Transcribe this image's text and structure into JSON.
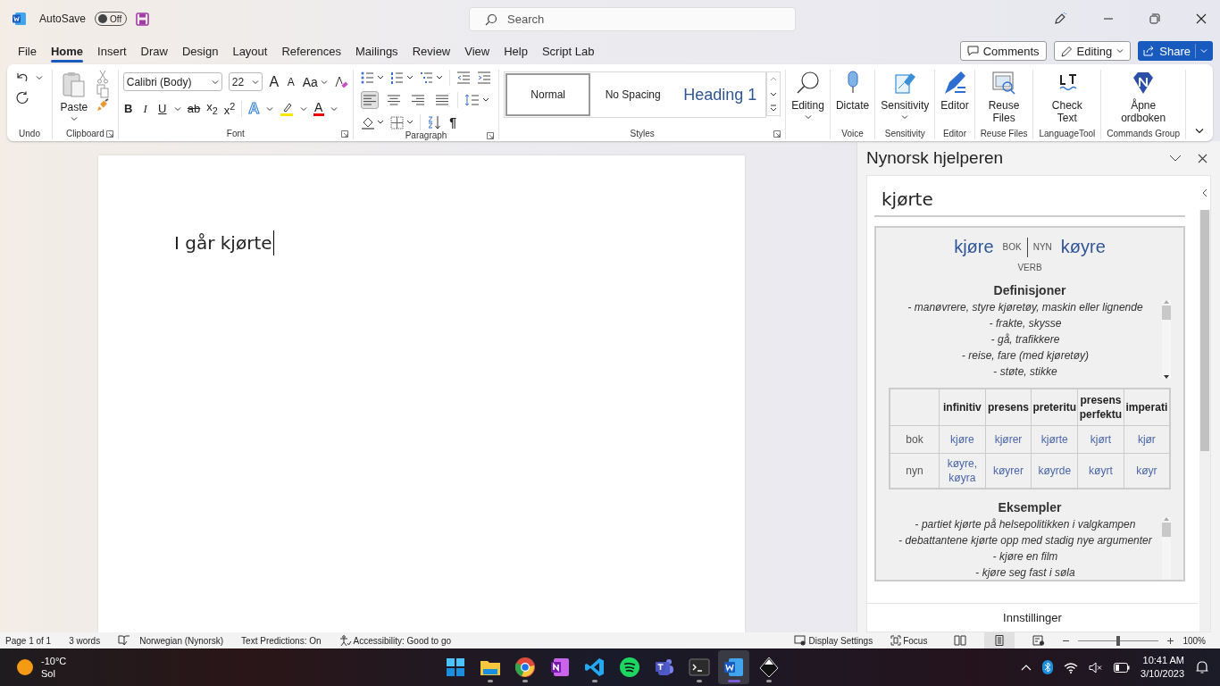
{
  "titlebar": {
    "autosave_label": "AutoSave",
    "autosave": {
      "on": false,
      "label": "Off"
    },
    "search": {
      "placeholder": "Search"
    }
  },
  "menu_tabs": [
    {
      "label": "File",
      "selected": false
    },
    {
      "label": "Home",
      "selected": true
    },
    {
      "label": "Insert",
      "selected": false
    },
    {
      "label": "Draw",
      "selected": false
    },
    {
      "label": "Design",
      "selected": false
    },
    {
      "label": "Layout",
      "selected": false
    },
    {
      "label": "References",
      "selected": false
    },
    {
      "label": "Mailings",
      "selected": false
    },
    {
      "label": "Review",
      "selected": false
    },
    {
      "label": "View",
      "selected": false
    },
    {
      "label": "Help",
      "selected": false
    },
    {
      "label": "Script Lab",
      "selected": false
    }
  ],
  "top_buttons": {
    "comments": "Comments",
    "editing": "Editing",
    "share": "Share"
  },
  "ribbon": {
    "undo": {
      "label": "Undo"
    },
    "clipboard": {
      "paste": "Paste",
      "label": "Clipboard"
    },
    "font": {
      "font_name": "Calibri (Body)",
      "font_size": "22",
      "case_button": "Aa",
      "size_buttons": [
        {
          "label": "A",
          "kind": "grow"
        },
        {
          "label": "A",
          "kind": "shrink"
        }
      ],
      "format_buttons": [
        {
          "label": "B",
          "kind": "bold"
        },
        {
          "label": "I",
          "kind": "italic"
        },
        {
          "label": "U",
          "kind": "underline"
        },
        {
          "label": "ab",
          "kind": "strike"
        },
        {
          "label": "x$_{2}$",
          "kind": "plain"
        },
        {
          "label": "x$^{2}$",
          "kind": "plain"
        }
      ],
      "color_buttons": [
        {
          "label": "A",
          "kind": "effect"
        },
        {
          "label": "A",
          "kind": "color"
        }
      ],
      "label": "Font"
    },
    "paragraph": {
      "align": [
        {
          "selected": true
        },
        {
          "selected": false
        },
        {
          "selected": false
        },
        {
          "selected": false
        }
      ],
      "pilcrow": "¶",
      "label": "Paragraph"
    },
    "styles": {
      "items": [
        {
          "label": "Normal",
          "selected": true,
          "kind": "body"
        },
        {
          "label": "No Spacing",
          "selected": false,
          "kind": "body"
        },
        {
          "label": "Heading 1",
          "selected": false,
          "kind": "heading"
        }
      ],
      "label": "Styles"
    },
    "big_buttons": [
      {
        "label": "Editing",
        "caret": true
      },
      {
        "label": "Dictate",
        "caret": false,
        "group": "Voice"
      },
      {
        "label": "Sensitivity",
        "caret": true,
        "group": "Sensitivity"
      },
      {
        "label": "Editor",
        "caret": false,
        "group": "Editor"
      },
      {
        "label": "Reuse Files",
        "caret": false,
        "group": "Reuse Files"
      },
      {
        "label": "Check Text",
        "caret": false,
        "group": "LanguageTool"
      },
      {
        "label": "Åpne ordboken",
        "caret": false,
        "group": "Commands Group"
      }
    ]
  },
  "document": {
    "text": "I går kjørte"
  },
  "task_pane": {
    "title": "Nynorsk hjelperen",
    "search": {
      "value": "kjørte"
    },
    "entry": {
      "bok_word": "kjøre",
      "bok_tag": "BOK",
      "nyn_tag": "NYN",
      "nyn_word": "køyre",
      "word_class": "VERB",
      "definitions_title": "Definisjoner",
      "definitions": [
        "- *manøvrere, styre kjøretøy, maskin eller lignende*",
        "- *frakte, skysse*",
        "- *gå, trafikkere*",
        "- *reise, fare (med kjøretøy)*",
        "- *støte, stikke*"
      ],
      "table": {
        "columns": [
          "infinitiv",
          "presens",
          "preteritu",
          "presens perfektu",
          "imperati"
        ],
        "rows": [
          {
            "label": "bok",
            "cells": [
              "kjøre",
              "kjører",
              "kjørte",
              "kjørt",
              "kjør"
            ]
          },
          {
            "label": "nyn",
            "cells": [
              "køyre, køyra",
              "køyrer",
              "køyrde",
              "køyrt",
              "køyr"
            ]
          }
        ]
      },
      "examples_title": "Eksempler",
      "examples": [
        "- *partiet kjørte på helsepolitikken i valgkampen*",
        "- *debattantene kjørte opp med stadig nye argumenter*",
        "- *kjøre en film*",
        "- *kjøre seg fast i søla*"
      ]
    },
    "settings_button": "Innstillinger"
  },
  "status_bar": {
    "page": "Page 1 of 1",
    "words": "3 words",
    "language": "Norwegian (Nynorsk)",
    "predictions": "Text Predictions: On",
    "accessibility": "Accessibility: Good to go",
    "display_settings": "Display Settings",
    "focus": "Focus",
    "views": [
      {
        "selected": false
      },
      {
        "selected": true
      },
      {
        "selected": false
      }
    ],
    "zoom": {
      "level": 0.5,
      "reading": "100%"
    }
  },
  "taskbar": {
    "weather": {
      "temperature": "-10°C",
      "condition": "Sol"
    },
    "apps": [
      {
        "running": false,
        "selected": false
      },
      {
        "running": true,
        "selected": false
      },
      {
        "running": true,
        "selected": false
      },
      {
        "running": false,
        "selected": false
      },
      {
        "running": true,
        "selected": false
      },
      {
        "running": false,
        "selected": false
      },
      {
        "running": false,
        "selected": false
      },
      {
        "running": true,
        "selected": false
      },
      {
        "running": true,
        "selected": true
      },
      {
        "running": true,
        "selected": false
      }
    ],
    "time": "10:41 AM",
    "date": "3/10/2023"
  }
}
